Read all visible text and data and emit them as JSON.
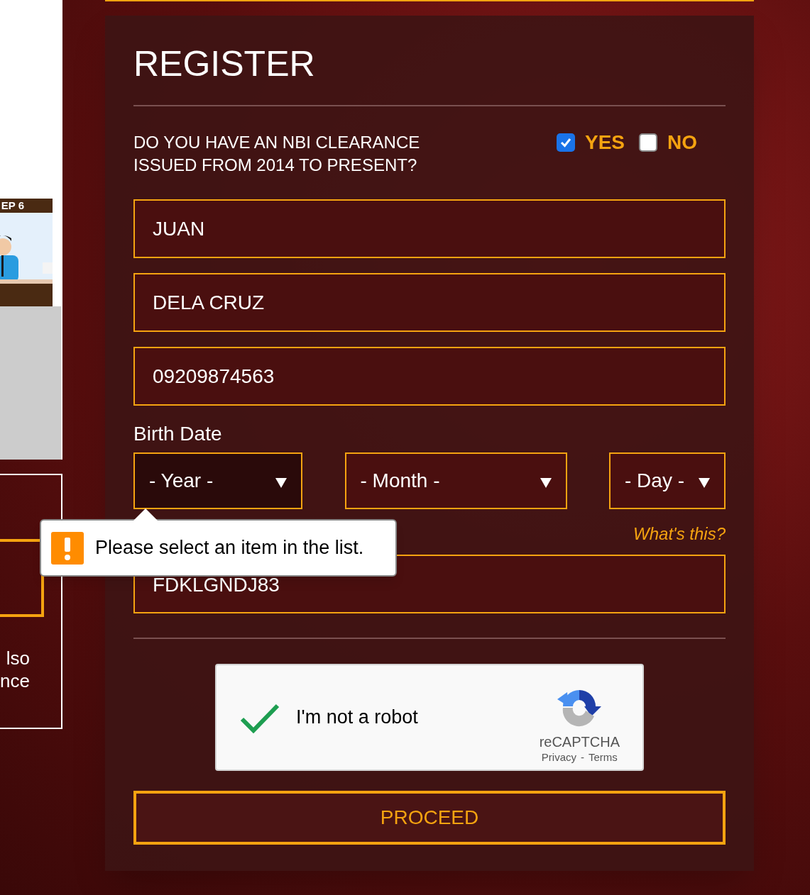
{
  "side_panel": {
    "banner": "EP 6",
    "card_text": [
      "lso",
      "nce"
    ]
  },
  "form": {
    "title": "REGISTER",
    "question": {
      "text": "DO YOU HAVE AN NBI CLEARANCE ISSUED FROM 2014 TO PRESENT?",
      "options": [
        {
          "label": "YES",
          "checked": true
        },
        {
          "label": "NO",
          "checked": false
        }
      ]
    },
    "fields": [
      {
        "value": "JUAN"
      },
      {
        "value": "DELA CRUZ"
      },
      {
        "value": "09209874563"
      }
    ],
    "birth_date": {
      "label": "Birth Date",
      "selects": [
        {
          "value": "- Year -",
          "focused": true
        },
        {
          "value": "- Month -",
          "focused": false
        },
        {
          "value": "- Day -",
          "focused": false
        }
      ]
    },
    "tooltip": {
      "text": "Please select an item in the list."
    },
    "help_link": "What's this?",
    "code_field": {
      "value": "FDKLGNDJ83"
    },
    "captcha": {
      "checked": true,
      "label": "I'm not a robot",
      "brand": "reCAPTCHA",
      "privacy": "Privacy",
      "separator": "-",
      "terms": "Terms"
    },
    "submit": "PROCEED"
  }
}
